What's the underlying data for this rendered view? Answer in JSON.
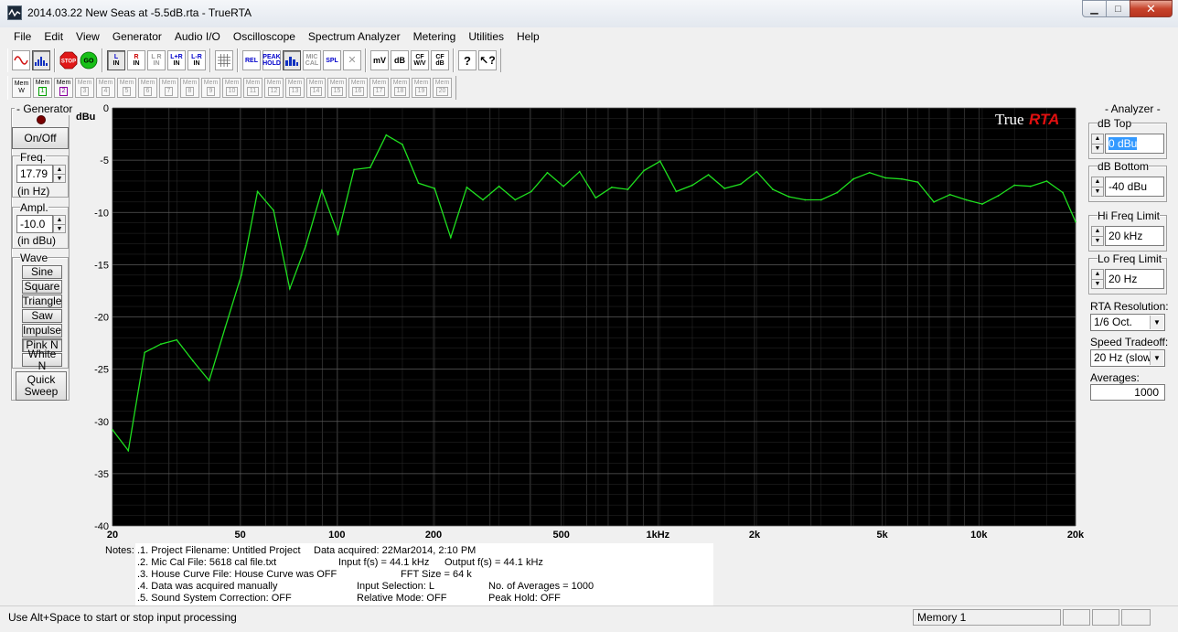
{
  "window": {
    "title": "2014.03.22 New Seas at -5.5dB.rta - TrueRTA"
  },
  "menu": [
    "File",
    "Edit",
    "View",
    "Generator",
    "Audio I/O",
    "Oscilloscope",
    "Spectrum Analyzer",
    "Metering",
    "Utilities",
    "Help"
  ],
  "toolbar": {
    "stop_label": "STOP",
    "go_label": "GO",
    "channels": [
      [
        "L",
        "IN"
      ],
      [
        "R",
        "IN"
      ],
      [
        "L R",
        "IN"
      ],
      [
        "L+R",
        "IN"
      ],
      [
        "L-R",
        "IN"
      ]
    ],
    "rel_label": "REL",
    "peak_hold_label": [
      "PEAK",
      "HOLD"
    ],
    "mic_cal_label": [
      "MIC",
      "CAL"
    ],
    "spl_label": "SPL",
    "mv_label": "mV",
    "db_label": "dB",
    "cf_wv_label": [
      "CF",
      "W/V"
    ],
    "cf_db_label": [
      "CF",
      "dB"
    ],
    "mem_label": "Mem",
    "mem_w": "W",
    "mem_numbers": [
      "1",
      "2",
      "3",
      "4",
      "5",
      "6",
      "7",
      "8",
      "9",
      "10",
      "11",
      "12",
      "13",
      "14",
      "15",
      "16",
      "17",
      "18",
      "19",
      "20"
    ]
  },
  "generator": {
    "caption": "- Generator -",
    "onoff": "On/Off",
    "freq_label": "Freq.",
    "freq_value": "17.79",
    "freq_unit": "(in Hz)",
    "ampl_label": "Ampl.",
    "ampl_value": "-10.0",
    "ampl_unit": "(in dBu)",
    "wave_label": "Wave",
    "waves": [
      "Sine",
      "Square",
      "Triangle",
      "Saw",
      "Impulse",
      "Pink N",
      "White N"
    ],
    "quick_sweep": [
      "Quick",
      "Sweep"
    ]
  },
  "analyzer": {
    "caption": "- Analyzer -",
    "db_top_label": "dB Top",
    "db_top_value": "0 dBu",
    "db_bottom_label": "dB Bottom",
    "db_bottom_value": "-40 dBu",
    "hi_freq_label": "Hi Freq Limit",
    "hi_freq_value": "20 kHz",
    "lo_freq_label": "Lo Freq Limit",
    "lo_freq_value": "20 Hz",
    "resolution_label": "RTA Resolution:",
    "resolution_value": "1/6 Oct.",
    "speed_label": "Speed Tradeoff:",
    "speed_value": "20 Hz (slow)",
    "averages_label": "Averages:",
    "averages_value": "1000"
  },
  "colors": {
    "chart_bg": "#000000",
    "grid": "#4a4a4a",
    "trace": "#1fe01f",
    "logo_red": "#e01010"
  },
  "chart_data": {
    "type": "line",
    "logo_true": "True",
    "logo_rta": "RTA",
    "ylabel": "dBu",
    "ylim": [
      -40,
      0
    ],
    "xlim": [
      20,
      20000
    ],
    "xscale": "log",
    "grid": true,
    "y_ticks": [
      "0",
      "-5",
      "-10",
      "-15",
      "-20",
      "-25",
      "-30",
      "-35",
      "-40"
    ],
    "x_ticks": [
      {
        "label": "20",
        "value": 20
      },
      {
        "label": "50",
        "value": 50
      },
      {
        "label": "100",
        "value": 100
      },
      {
        "label": "200",
        "value": 200
      },
      {
        "label": "500",
        "value": 500
      },
      {
        "label": "1kHz",
        "value": 1000
      },
      {
        "label": "2k",
        "value": 2000
      },
      {
        "label": "5k",
        "value": 5000
      },
      {
        "label": "10k",
        "value": 10000
      },
      {
        "label": "20k",
        "value": 20000
      }
    ],
    "series": [
      {
        "x": [
          20,
          22.4,
          25.2,
          28.3,
          31.7,
          35.6,
          40,
          44.9,
          50.4,
          56.6,
          63.5,
          71.3,
          80,
          89.8,
          100.8,
          113.1,
          127,
          142.5,
          160,
          179.6,
          201.6,
          226.3,
          254,
          285.1,
          320,
          359.2,
          403.2,
          452.5,
          508,
          570.2,
          640,
          718.4,
          806.3,
          905.1,
          1016,
          1140.4,
          1280,
          1436.8,
          1612.7,
          1810.2,
          2031.9,
          2280.7,
          2560,
          2873.5,
          3225.4,
          3620.4,
          4063.7,
          4561.4,
          5120,
          5747,
          6450.8,
          7240.8,
          8127.5,
          9122.8,
          10240,
          11494,
          12901.6,
          14481.5,
          16255,
          18245.6,
          20000
        ],
        "y": [
          -30.8,
          -32.8,
          -23.4,
          -22.6,
          -22.2,
          -24.2,
          -26.1,
          -21,
          -16,
          -8,
          -9.8,
          -17.3,
          -13.2,
          -7.9,
          -12.1,
          -5.9,
          -5.7,
          -2.6,
          -3.5,
          -7.2,
          -7.7,
          -12.4,
          -7.6,
          -8.8,
          -7.5,
          -8.8,
          -8,
          -6.2,
          -7.5,
          -6.1,
          -8.6,
          -7.6,
          -7.8,
          -6,
          -5.1,
          -8,
          -7.4,
          -6.4,
          -7.7,
          -7.3,
          -6.1,
          -7.8,
          -8.5,
          -8.8,
          -8.8,
          -8.1,
          -6.8,
          -6.2,
          -6.7,
          -6.8,
          -7.1,
          -9,
          -8.3,
          -8.8,
          -9.2,
          -8.4,
          -7.4,
          -7.5,
          -7,
          -8.1,
          -10.9
        ]
      }
    ]
  },
  "notes": {
    "label": "Notes:",
    "lines": [
      ".1. Project Filename: Untitled Project",
      ".2. Mic Cal File: 5618 cal file.txt",
      ".3. House Curve File: House Curve was OFF",
      ".4. Data was acquired manually",
      ".5. Sound System Correction: OFF"
    ],
    "data_acquired": "Data acquired: 22Mar2014, 2:10 PM",
    "input_fs": "Input f(s) = 44.1 kHz",
    "output_fs": "Output f(s) = 44.1 kHz",
    "fft_size": "FFT Size = 64 k",
    "input_selection": "Input Selection: L",
    "averages": "No. of Averages = 1000",
    "relative_mode": "Relative Mode:  OFF",
    "peak_hold": "Peak Hold: OFF"
  },
  "status": {
    "hint": "Use Alt+Space to start or stop input processing",
    "memory": "Memory 1"
  }
}
